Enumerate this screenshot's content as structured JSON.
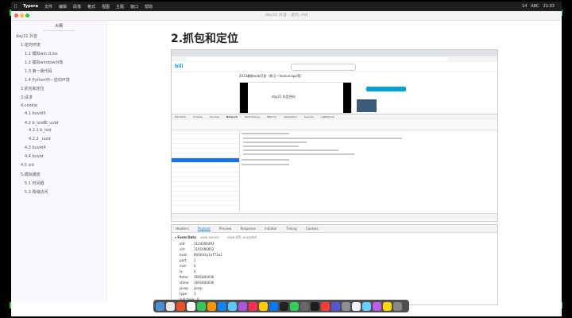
{
  "menubar": {
    "app": "Typora",
    "items": [
      "文件",
      "编辑",
      "段落",
      "格式",
      "视图",
      "主题",
      "窗口",
      "帮助"
    ],
    "right": [
      "14",
      "ABC",
      "21:03"
    ]
  },
  "window": {
    "title": "day21 抖音 - 逆向 .md"
  },
  "sidebar": {
    "tab": "大纲",
    "items": [
      {
        "label": "day21 抖音"
      },
      {
        "label": "1.逆向环境"
      },
      {
        "label": "1.1 模拟win.d.ios"
      },
      {
        "label": "1.2 模拟window对象"
      },
      {
        "label": "1.3 第一版代码"
      },
      {
        "label": "1.4 Python中—逆向环境"
      },
      {
        "label": "2.抓包和定位"
      },
      {
        "label": "3.请求"
      },
      {
        "label": "4.cookie"
      },
      {
        "label": "4.1 buvid3"
      },
      {
        "label": "4.2 b_lsid和_uuid"
      },
      {
        "label": "4.2.1 b_lsid"
      },
      {
        "label": "4.2.2 _uuid"
      },
      {
        "label": "4.3 buvid4"
      },
      {
        "label": "4.4 buvid"
      },
      {
        "label": "4.5 sid"
      },
      {
        "label": "5.模拟播放"
      },
      {
        "label": "5.1 时间戳"
      },
      {
        "label": "5.2 跨域访问"
      }
    ]
  },
  "main": {
    "heading": "2.抓包和定位",
    "shot1": {
      "site_logo": "bili",
      "video_title": "2023最新web开发（练习一Vue/uniapp等）",
      "player_caption": "day21 抖音逆向",
      "devtools_tabs": [
        "Elements",
        "Console",
        "Sources",
        "Network",
        "Performance",
        "Memory",
        "Application",
        "Security",
        "Lighthouse"
      ]
    },
    "shot2": {
      "tabs": [
        "Headers",
        "Payload",
        "Preview",
        "Response",
        "Initiator",
        "Timing",
        "Cookies"
      ],
      "active_tab": "Payload",
      "form_data_label": "▾ Form Data",
      "view_source": "view source",
      "view_url": "view URL-encoded",
      "fields": [
        {
          "k": "aid:",
          "v": "1124306493"
        },
        {
          "k": "cid:",
          "v": "1101486852"
        },
        {
          "k": "bvid:",
          "v": "BV1KV4y1o7T3a1"
        },
        {
          "k": "part:",
          "v": "1"
        },
        {
          "k": "mid:",
          "v": "0"
        },
        {
          "k": "lv:",
          "v": "0"
        },
        {
          "k": "ftime:",
          "v": "1691804636"
        },
        {
          "k": "stime:",
          "v": "1691804636"
        },
        {
          "k": "jsonp:",
          "v": "jsonp"
        },
        {
          "k": "type:",
          "v": "3"
        },
        {
          "k": "sub_type:",
          "v": "0"
        }
      ]
    }
  },
  "dock": {
    "colors": [
      "#4a90d9",
      "#e8e8e8",
      "#f04e23",
      "#ffffff",
      "#34c759",
      "#ff9500",
      "#0a84ff",
      "#5ac8fa",
      "#af52de",
      "#ff2d55",
      "#ffcc00",
      "#007aff",
      "#222",
      "#30d158",
      "#666",
      "#1d1d1f",
      "#ff3b30",
      "#5856d6",
      "#8e8e93",
      "#f2f2f7",
      "#64d2ff",
      "#bf5af2",
      "#ffd60a",
      "#888"
    ]
  }
}
